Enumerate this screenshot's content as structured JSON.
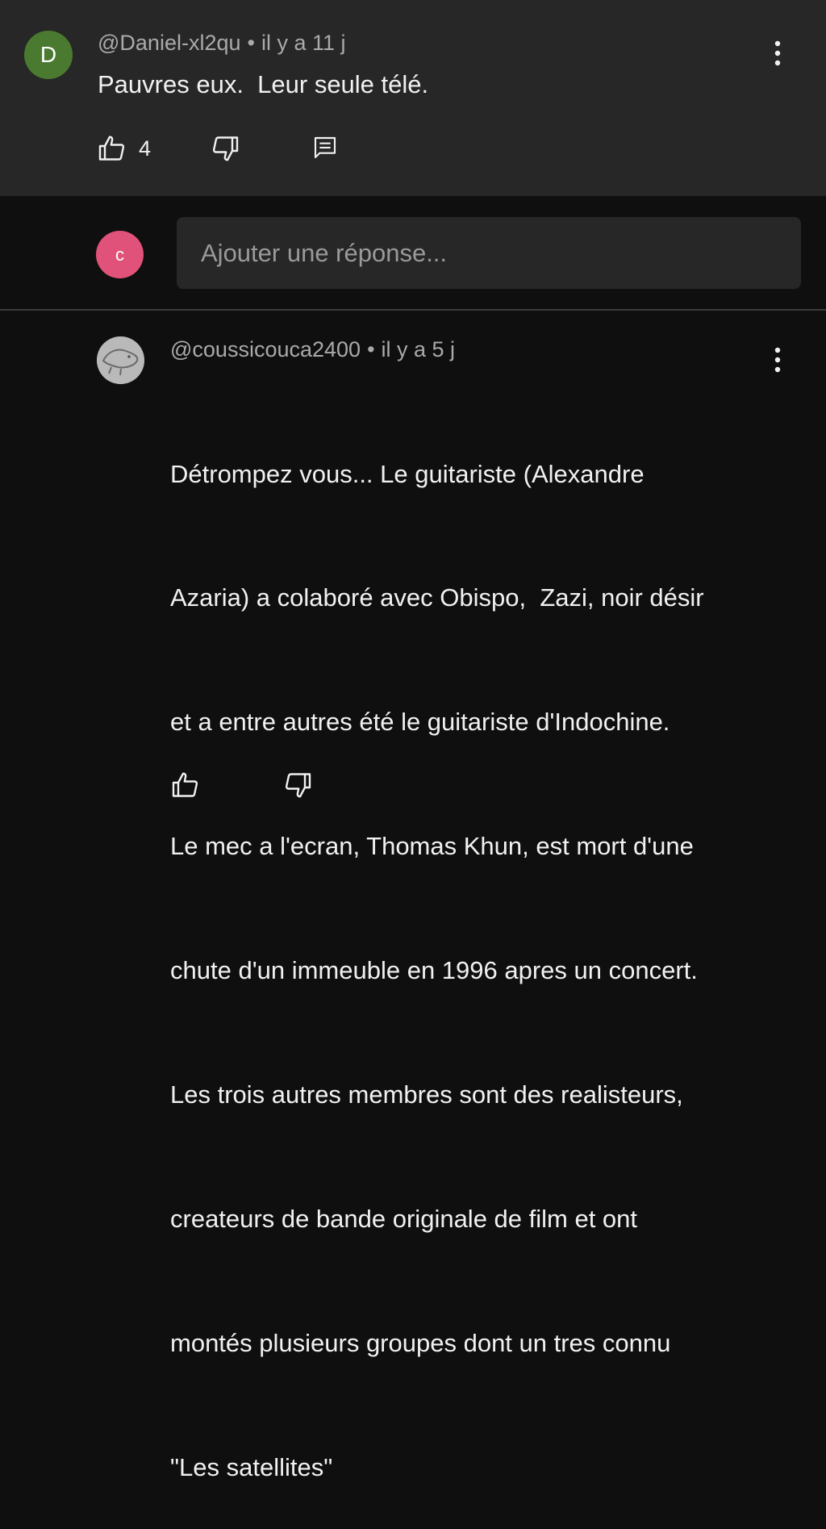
{
  "comment": {
    "avatar_letter": "D",
    "author": "@Daniel-xl2qu",
    "separator": "•",
    "time": "il y a 11 j",
    "text": "Pauvres eux.  Leur seule télé.",
    "likes": "4"
  },
  "reply_box": {
    "avatar_letter": "c",
    "placeholder": "Ajouter une réponse..."
  },
  "reply": {
    "author": "@coussicouca2400",
    "separator": "•",
    "time": "il y a 5 j",
    "lines": [
      "Détrompez vous... Le guitariste (Alexandre",
      "Azaria) a colaboré avec Obispo,  Zazi, noir désir",
      "et a entre autres été le guitariste d'Indochine.",
      "Le mec a l'ecran, Thomas Khun, est mort d'une",
      "chute d'un immeuble en 1996 apres un concert.",
      "Les trois autres membres sont des realisteurs,",
      "createurs de bande originale de film et ont",
      "montés plusieurs groupes dont un tres connu",
      "\"Les satellites\""
    ]
  },
  "icons": {
    "like": "thumbs-up-icon",
    "dislike": "thumbs-down-icon",
    "reply": "comment-icon",
    "more": "more-vert-icon"
  }
}
